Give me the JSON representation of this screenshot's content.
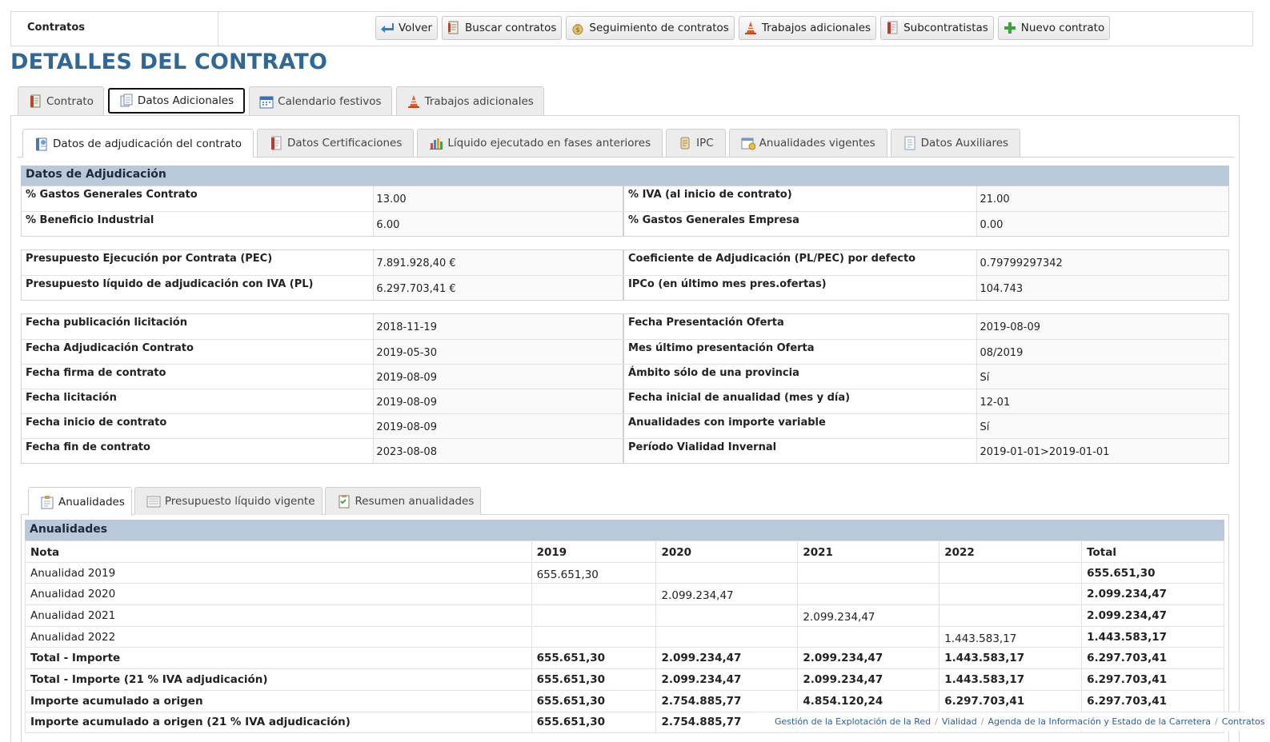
{
  "breadcrumb_section": "Contratos",
  "toolbar": [
    {
      "label": "Volver",
      "icon": "arrow-back-icon"
    },
    {
      "label": "Buscar contratos",
      "icon": "document-search-icon"
    },
    {
      "label": "Seguimiento de contratos",
      "icon": "money-bag-icon"
    },
    {
      "label": "Trabajos adicionales",
      "icon": "traffic-cone-icon"
    },
    {
      "label": "Subcontratistas",
      "icon": "document-red-icon"
    },
    {
      "label": "Nuevo contrato",
      "icon": "plus-icon"
    }
  ],
  "page_title": "DETALLES DEL CONTRATO",
  "main_tabs": [
    {
      "label": "Contrato",
      "active": false
    },
    {
      "label": "Datos Adicionales",
      "active": true
    },
    {
      "label": "Calendario festivos",
      "active": false
    },
    {
      "label": "Trabajos adicionales",
      "active": false
    }
  ],
  "sub_tabs": [
    {
      "label": "Datos de adjudicación del contrato",
      "active": true
    },
    {
      "label": "Datos Certificaciones",
      "active": false
    },
    {
      "label": "Líquido ejecutado en fases anteriores",
      "active": false
    },
    {
      "label": "IPC",
      "active": false
    },
    {
      "label": "Anualidades vigentes",
      "active": false
    },
    {
      "label": "Datos Auxiliares",
      "active": false
    }
  ],
  "adjudicacion": {
    "title": "Datos de Adjudicación",
    "group1": [
      [
        "% Gastos Generales Contrato",
        "13.00",
        "% IVA (al inicio de contrato)",
        "21.00"
      ],
      [
        "% Beneficio Industrial",
        "6.00",
        "% Gastos Generales Empresa",
        "0.00"
      ]
    ],
    "group2": [
      [
        "Presupuesto Ejecución por Contrata (PEC)",
        "7.891.928,40 €",
        "Coeficiente de Adjudicación (PL/PEC) por defecto",
        "0.79799297342"
      ],
      [
        "Presupuesto líquido de adjudicación con IVA (PL)",
        "6.297.703,41 €",
        "IPCo (en último mes pres.ofertas)",
        "104.743"
      ]
    ],
    "group3": [
      [
        "Fecha publicación licitación",
        "2018-11-19",
        "Fecha Presentación Oferta",
        "2019-08-09"
      ],
      [
        "Fecha Adjudicación Contrato",
        "2019-05-30",
        "Mes último presentación Oferta",
        "08/2019"
      ],
      [
        "Fecha firma de contrato",
        "2019-08-09",
        "Ámbito sólo de una provincia",
        "Sí"
      ],
      [
        "Fecha licitación",
        "2019-08-09",
        "Fecha inicial de anualidad (mes y día)",
        "12-01"
      ],
      [
        "Fecha inicio de contrato",
        "2019-08-09",
        "Anualidades con importe variable",
        "Sí"
      ],
      [
        "Fecha fin de contrato",
        "2023-08-08",
        "Período Vialidad Invernal",
        "2019-01-01>2019-01-01"
      ]
    ]
  },
  "bottom_tabs": [
    {
      "label": "Anualidades",
      "active": true
    },
    {
      "label": "Presupuesto líquido vigente",
      "active": false
    },
    {
      "label": "Resumen anualidades",
      "active": false
    }
  ],
  "anualidades": {
    "title": "Anualidades",
    "columns": [
      "Nota",
      "2019",
      "2020",
      "2021",
      "2022",
      "Total"
    ],
    "rows": [
      {
        "bold": false,
        "cells": [
          "Anualidad 2019",
          "655.651,30",
          "",
          "",
          "",
          "655.651,30"
        ]
      },
      {
        "bold": false,
        "cells": [
          "Anualidad 2020",
          "",
          "2.099.234,47",
          "",
          "",
          "2.099.234,47"
        ]
      },
      {
        "bold": false,
        "cells": [
          "Anualidad 2021",
          "",
          "",
          "2.099.234,47",
          "",
          "2.099.234,47"
        ]
      },
      {
        "bold": false,
        "cells": [
          "Anualidad 2022",
          "",
          "",
          "",
          "1.443.583,17",
          "1.443.583,17"
        ]
      },
      {
        "bold": true,
        "cells": [
          "Total - Importe",
          "655.651,30",
          "2.099.234,47",
          "2.099.234,47",
          "1.443.583,17",
          "6.297.703,41"
        ]
      },
      {
        "bold": true,
        "cells": [
          "Total - Importe (21 % IVA adjudicación)",
          "655.651,30",
          "2.099.234,47",
          "2.099.234,47",
          "1.443.583,17",
          "6.297.703,41"
        ]
      },
      {
        "bold": true,
        "cells": [
          "Importe acumulado a origen",
          "655.651,30",
          "2.754.885,77",
          "4.854.120,24",
          "6.297.703,41",
          "6.297.703,41"
        ]
      },
      {
        "bold": true,
        "cells": [
          "Importe acumulado a origen (21 % IVA adjudicación)",
          "655.651,30",
          "2.754.885,77",
          "",
          "",
          ""
        ]
      }
    ]
  },
  "footer_breadcrumb": [
    "Gestión de la Explotación de la Red",
    "Vialidad",
    "Agenda de la Información y Estado de la Carretera",
    "Contratos"
  ]
}
